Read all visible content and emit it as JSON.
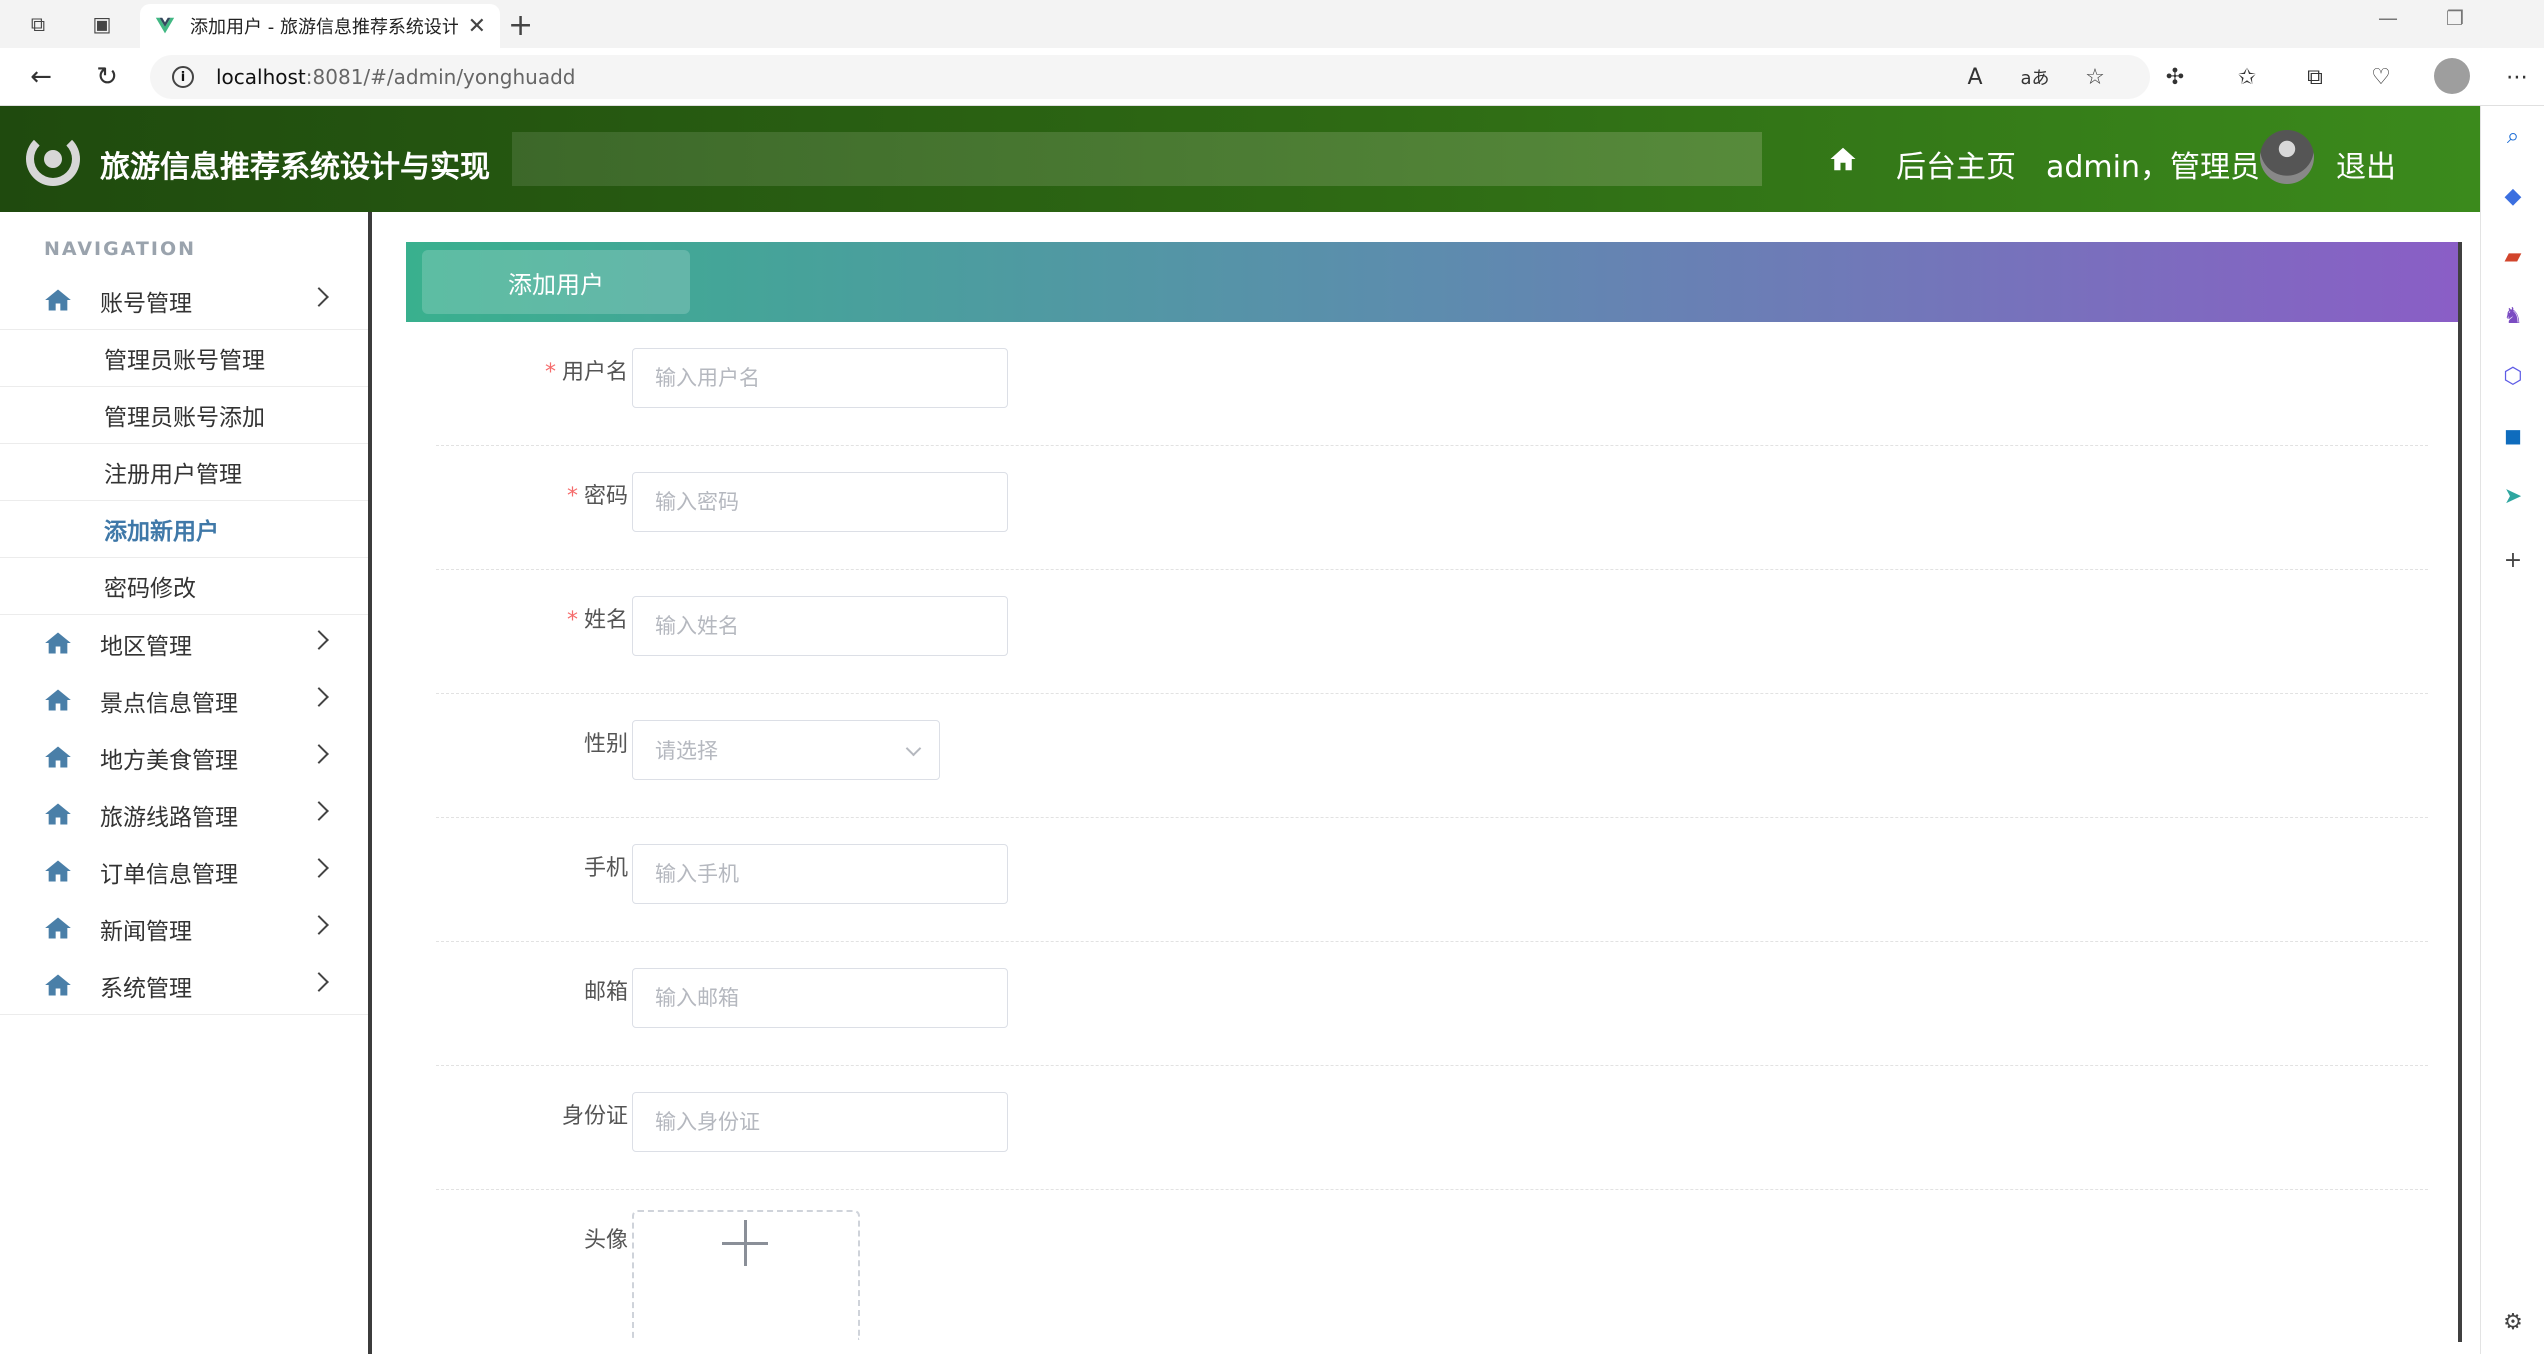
{
  "browser": {
    "tab_title": "添加用户 - 旅游信息推荐系统设计",
    "new_tab_label": "+",
    "url_host": "localhost",
    "url_rest": ":8081/#/admin/yonghuadd",
    "read_aloud_label": "A",
    "translate_label": "aあ"
  },
  "header": {
    "site_title": "旅游信息推荐系统设计与实现",
    "home_label": "后台主页",
    "user_label": "admin，管理员",
    "logout_label": "退出",
    "theme_color": "#2e6a14"
  },
  "sidebar": {
    "nav_heading": "NAVIGATION",
    "menus": [
      {
        "label": "账号管理",
        "expanded": true
      },
      {
        "label": "地区管理"
      },
      {
        "label": "景点信息管理"
      },
      {
        "label": "地方美食管理"
      },
      {
        "label": "旅游线路管理"
      },
      {
        "label": "订单信息管理"
      },
      {
        "label": "新闻管理"
      },
      {
        "label": "系统管理"
      }
    ],
    "account_sub": [
      {
        "label": "管理员账号管理"
      },
      {
        "label": "管理员账号添加"
      },
      {
        "label": "注册用户管理"
      },
      {
        "label": "添加新用户",
        "active": true
      },
      {
        "label": "密码修改"
      }
    ],
    "active_color": "#3f78a8"
  },
  "main": {
    "card_title": "添加用户",
    "fields": [
      {
        "label": "用户名",
        "required": true,
        "placeholder": "输入用户名",
        "value": ""
      },
      {
        "label": "密码",
        "required": true,
        "placeholder": "输入密码",
        "value": ""
      },
      {
        "label": "姓名",
        "required": true,
        "placeholder": "输入姓名",
        "value": ""
      },
      {
        "label": "性别",
        "required": false,
        "placeholder": "请选择",
        "type": "select"
      },
      {
        "label": "手机",
        "required": false,
        "placeholder": "输入手机",
        "value": ""
      },
      {
        "label": "邮箱",
        "required": false,
        "placeholder": "输入邮箱",
        "value": ""
      },
      {
        "label": "身份证",
        "required": false,
        "placeholder": "输入身份证",
        "value": ""
      },
      {
        "label": "头像",
        "required": false,
        "type": "upload"
      }
    ],
    "required_mark": "*"
  },
  "icons": {
    "home": "home-icon",
    "chevron": "chevron-right-icon",
    "upload": "plus-icon"
  }
}
